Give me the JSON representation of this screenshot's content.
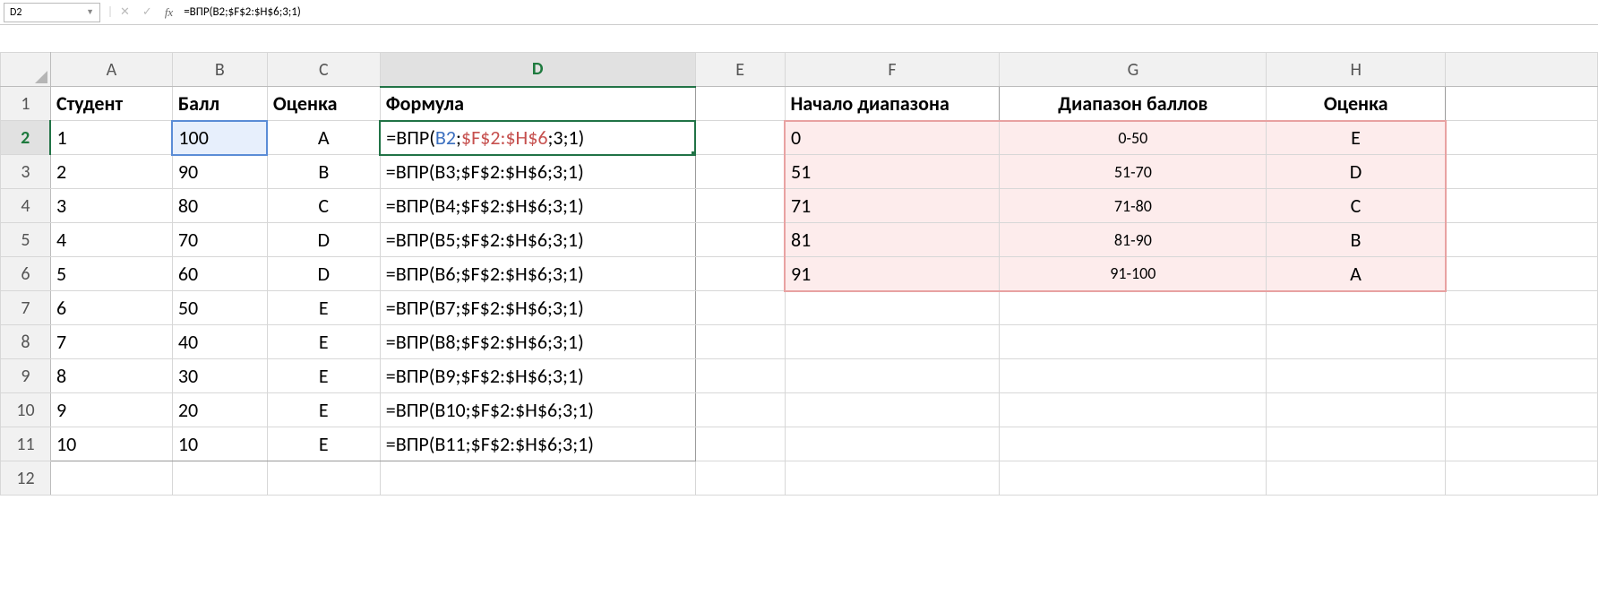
{
  "nameBox": "D2",
  "formulaBarText": "=ВПР(B2;$F$2:$H$6;3;1)",
  "columns": [
    "A",
    "B",
    "C",
    "D",
    "E",
    "F",
    "G",
    "H"
  ],
  "rowNumbers": [
    1,
    2,
    3,
    4,
    5,
    6,
    7,
    8,
    9,
    10,
    11,
    12
  ],
  "activeCol": "D",
  "activeRow": 2,
  "blueCell": "B2",
  "headers": {
    "A": "Студент",
    "B": "Балл",
    "C": "Оценка",
    "D": "Формула",
    "F": "Начало диапазона",
    "G": "Диапазон баллов",
    "H": "Оценка"
  },
  "students": [
    {
      "n": "1",
      "score": "100",
      "grade": "A",
      "formula": "=ВПР(B2;$F$2:$H$6;3;1)"
    },
    {
      "n": "2",
      "score": "90",
      "grade": "B",
      "formula": "=ВПР(B3;$F$2:$H$6;3;1)"
    },
    {
      "n": "3",
      "score": "80",
      "grade": "C",
      "formula": "=ВПР(B4;$F$2:$H$6;3;1)"
    },
    {
      "n": "4",
      "score": "70",
      "grade": "D",
      "formula": "=ВПР(B5;$F$2:$H$6;3;1)"
    },
    {
      "n": "5",
      "score": "60",
      "grade": "D",
      "formula": "=ВПР(B6;$F$2:$H$6;3;1)"
    },
    {
      "n": "6",
      "score": "50",
      "grade": "E",
      "formula": "=ВПР(B7;$F$2:$H$6;3;1)"
    },
    {
      "n": "7",
      "score": "40",
      "grade": "E",
      "formula": "=ВПР(B8;$F$2:$H$6;3;1)"
    },
    {
      "n": "8",
      "score": "30",
      "grade": "E",
      "formula": "=ВПР(B9;$F$2:$H$6;3;1)"
    },
    {
      "n": "9",
      "score": "20",
      "grade": "E",
      "formula": "=ВПР(B10;$F$2:$H$6;3;1)"
    },
    {
      "n": "10",
      "score": "10",
      "grade": "E",
      "formula": "=ВПР(B11;$F$2:$H$6;3;1)"
    }
  ],
  "lookup": [
    {
      "start": "0",
      "range": "0-50",
      "grade": "E"
    },
    {
      "start": "51",
      "range": "51-70",
      "grade": "D"
    },
    {
      "start": "71",
      "range": "71-80",
      "grade": "C"
    },
    {
      "start": "81",
      "range": "81-90",
      "grade": "B"
    },
    {
      "start": "91",
      "range": "91-100",
      "grade": "A"
    }
  ],
  "d2_formula_parts": {
    "p1": "=ВПР(",
    "p2": "B2",
    "p3": ";",
    "p4": "$F$2:$H$6",
    "p5": ";3;1)"
  }
}
